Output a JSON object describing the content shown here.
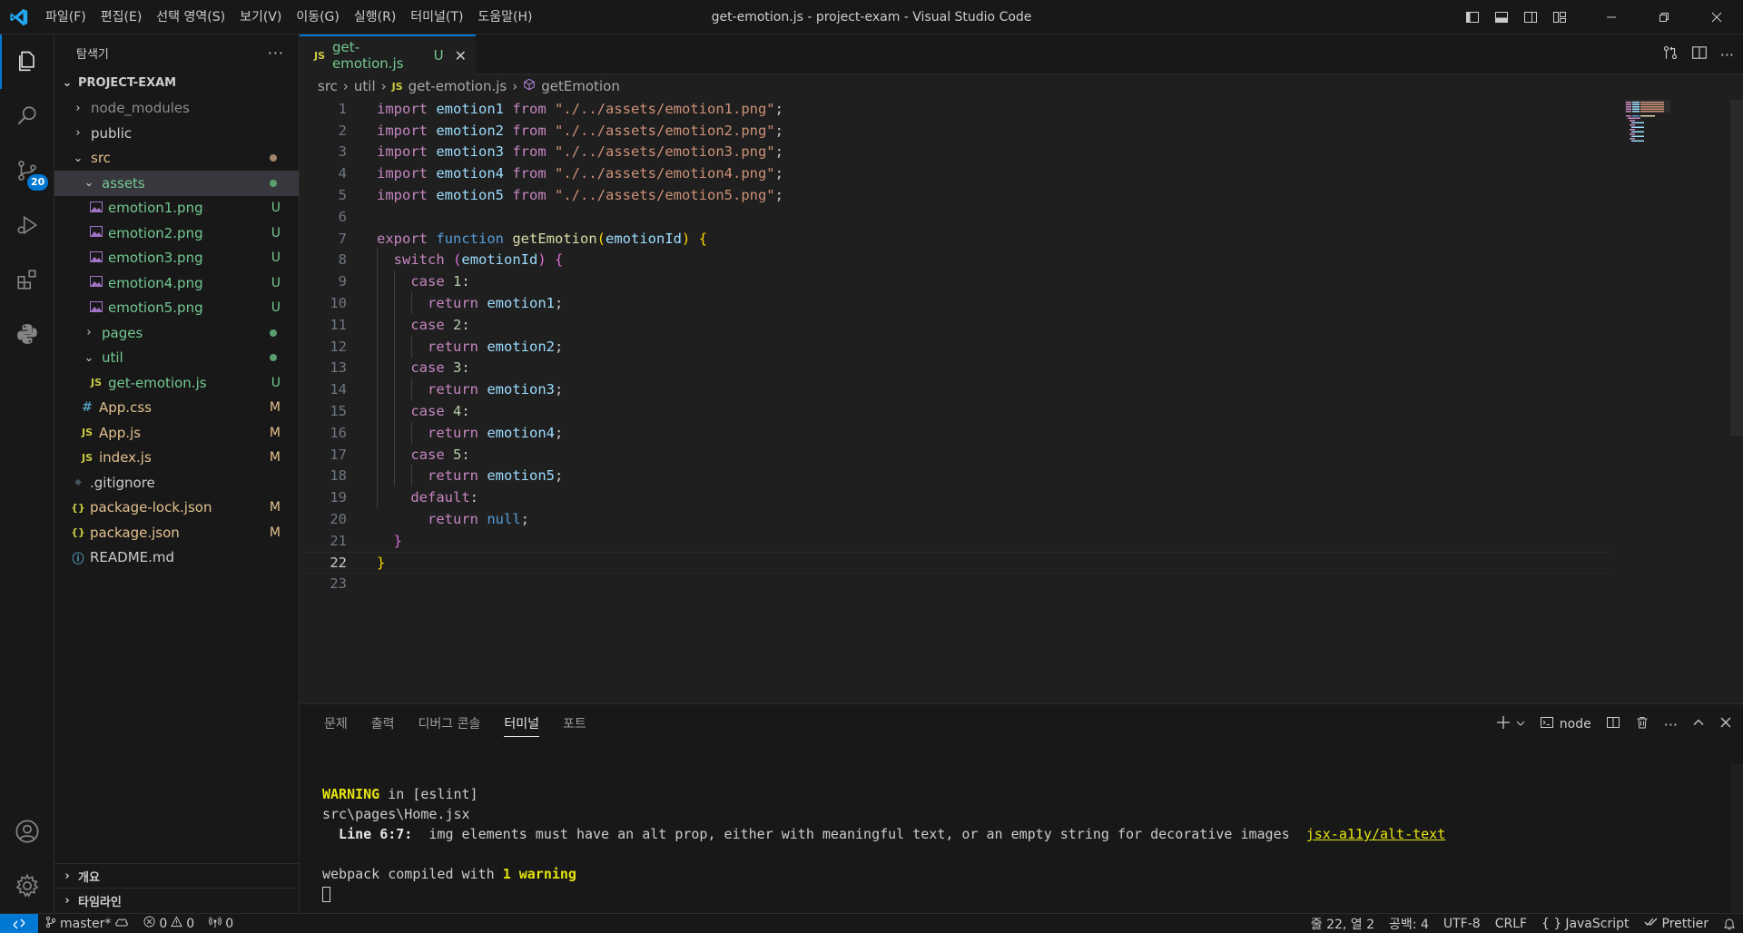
{
  "titlebar": {
    "title": "get-emotion.js - project-exam - Visual Studio Code",
    "menu": [
      "파일(F)",
      "편집(E)",
      "선택 영역(S)",
      "보기(V)",
      "이동(G)",
      "실행(R)",
      "터미널(T)",
      "도움말(H)"
    ]
  },
  "activity": {
    "scm_badge": "20"
  },
  "explorer": {
    "header": "탐색기",
    "more": "···",
    "project": "PROJECT-EXAM",
    "items": [
      {
        "label": "node_modules",
        "twisty": "›",
        "status": ""
      },
      {
        "label": "public",
        "twisty": "›",
        "status": ""
      },
      {
        "label": "src",
        "twisty": "⌄",
        "status": ""
      },
      {
        "label": "assets",
        "twisty": "⌄",
        "status": ""
      },
      {
        "label": "emotion1.png",
        "status": "U"
      },
      {
        "label": "emotion2.png",
        "status": "U"
      },
      {
        "label": "emotion3.png",
        "status": "U"
      },
      {
        "label": "emotion4.png",
        "status": "U"
      },
      {
        "label": "emotion5.png",
        "status": "U"
      },
      {
        "label": "pages",
        "twisty": "›",
        "status": ""
      },
      {
        "label": "util",
        "twisty": "⌄",
        "status": ""
      },
      {
        "label": "get-emotion.js",
        "icon": "JS",
        "status": "U"
      },
      {
        "label": "App.css",
        "icon": "#",
        "status": "M"
      },
      {
        "label": "App.js",
        "icon": "JS",
        "status": "M"
      },
      {
        "label": "index.js",
        "icon": "JS",
        "status": "M"
      },
      {
        "label": ".gitignore",
        "icon": "◆",
        "status": ""
      },
      {
        "label": "package-lock.json",
        "icon": "{}",
        "status": "M"
      },
      {
        "label": "package.json",
        "icon": "{}",
        "status": "M"
      },
      {
        "label": "README.md",
        "icon": "ⓘ",
        "status": ""
      }
    ],
    "outline": "개요",
    "timeline": "타임라인"
  },
  "editor": {
    "tab": {
      "icon": "JS",
      "name": "get-emotion.js",
      "status": "U",
      "close": "✕"
    },
    "breadcrumb": {
      "src": "src",
      "util": "util",
      "sep": "›",
      "file_icon": "JS",
      "file": "get-emotion.js",
      "symbol": "getEmotion"
    },
    "line_numbers": [
      "1",
      "2",
      "3",
      "4",
      "5",
      "6",
      "7",
      "8",
      "9",
      "10",
      "11",
      "12",
      "13",
      "14",
      "15",
      "16",
      "17",
      "18",
      "19",
      "20",
      "21",
      "22",
      "23"
    ],
    "code": {
      "import": "import",
      "from": "from",
      "emotions": [
        "emotion1",
        "emotion2",
        "emotion3",
        "emotion4",
        "emotion5"
      ],
      "paths": [
        "\"./../assets/emotion1.png\"",
        "\"./../assets/emotion2.png\"",
        "\"./../assets/emotion3.png\"",
        "\"./../assets/emotion4.png\"",
        "\"./../assets/emotion5.png\""
      ],
      "export": "export",
      "function": "function",
      "fn_name": "getEmotion",
      "param": "emotionId",
      "switch": "switch",
      "case": "case",
      "return": "return",
      "default": "default",
      "null": "null",
      "cases": [
        "1",
        "2",
        "3",
        "4",
        "5"
      ]
    }
  },
  "panel": {
    "tabs": [
      "문제",
      "출력",
      "디버그 콘솔",
      "터미널",
      "포트"
    ],
    "active_tab": "터미널",
    "terminal_name": "node",
    "terminal": {
      "warning_label": "WARNING",
      "warning_rest": " in [eslint]",
      "file": "src\\pages\\Home.jsx",
      "line_label": "  Line 6:7:",
      "line_msg": "  img elements must have an alt prop, either with meaningful text, or an empty string for decorative images  ",
      "rule": "jsx-a11y/alt-text",
      "compiled": "webpack compiled with ",
      "compiled_warn": "1 warning"
    }
  },
  "status": {
    "branch": "master*",
    "errors": "0",
    "warnings": "0",
    "ports": "0",
    "position": "줄 22, 열 2",
    "indent": "공백: 4",
    "encoding": "UTF-8",
    "eol": "CRLF",
    "language": "JavaScript",
    "formatter": "Prettier"
  },
  "colors": {
    "accent": "#0078d4",
    "untracked": "#73c991",
    "modified": "#e2c08d"
  }
}
